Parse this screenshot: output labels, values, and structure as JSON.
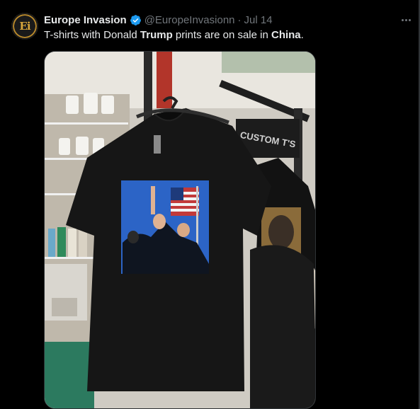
{
  "author": {
    "display_name": "Europe Invasion",
    "avatar_initials": "Ei",
    "handle": "@EuropeInvasionn",
    "separator": "·",
    "timestamp": "Jul 14",
    "verified": true
  },
  "tweet": {
    "text_parts": {
      "p1": "T-shirts with Donald ",
      "b1": "Trump",
      "p2": " prints are on sale in ",
      "b2": "China",
      "p3": "."
    }
  },
  "media": {
    "sign_text": "CUSTOM T'S",
    "description": "photo"
  },
  "colors": {
    "background": "#000000",
    "text": "#e7e9ea",
    "muted": "#71767b",
    "verified_blue": "#1d9bf0",
    "border": "#2f3336"
  },
  "icons": {
    "verified": "verified-badge-icon",
    "more": "more-options-icon"
  }
}
